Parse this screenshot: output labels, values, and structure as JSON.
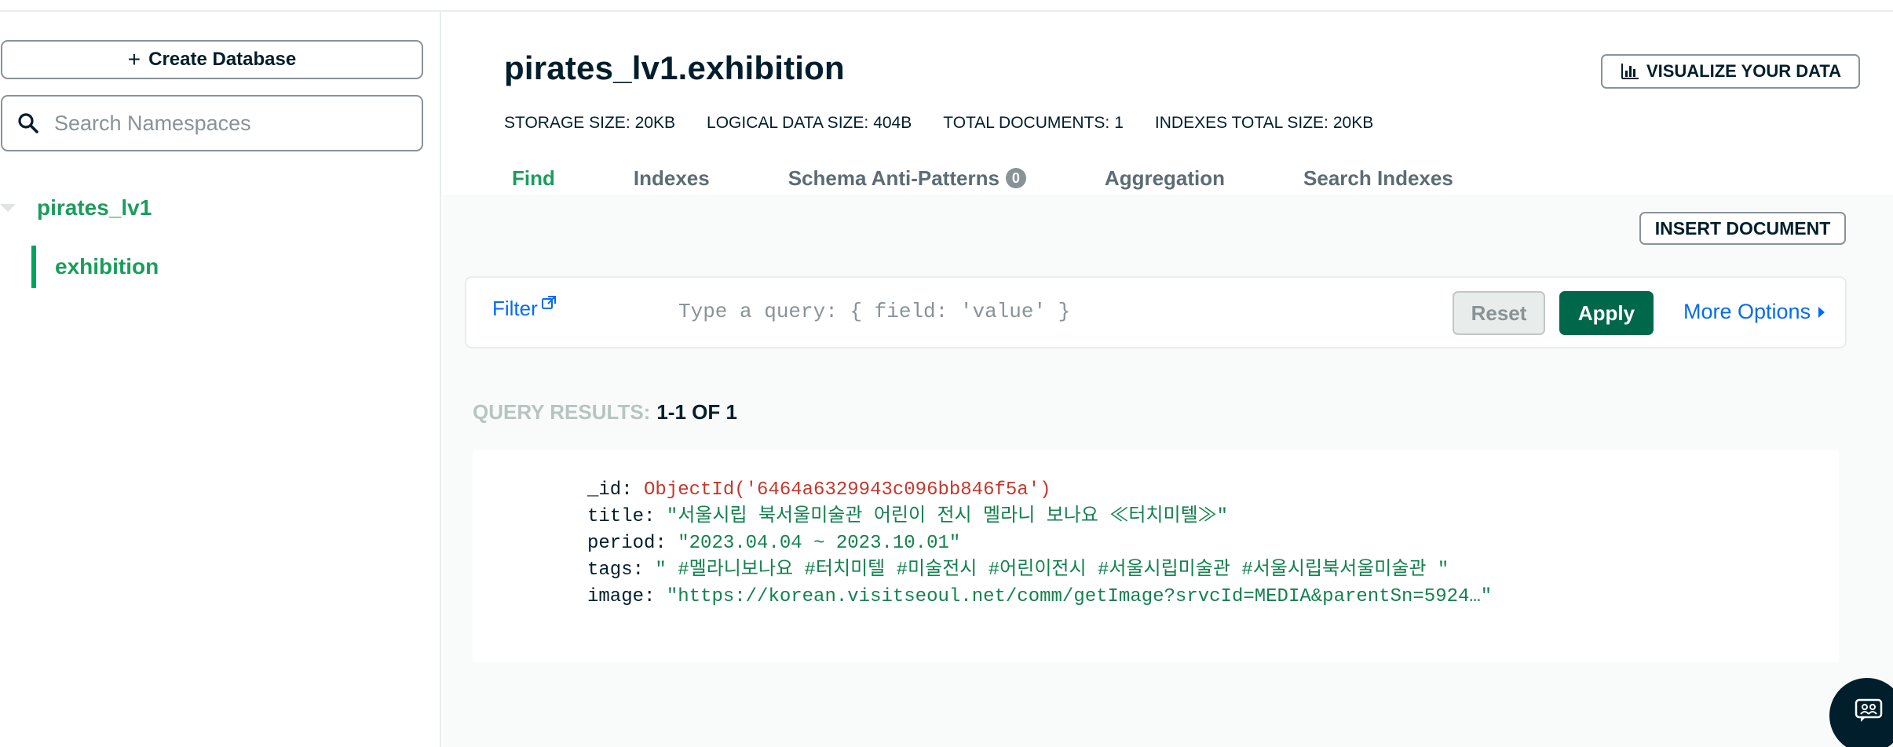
{
  "sidebar": {
    "create_database_label": "Create Database",
    "search_placeholder": "Search Namespaces",
    "database": "pirates_lv1",
    "collection": "exhibition"
  },
  "header": {
    "title": "pirates_lv1.exhibition",
    "visualize_label": "VISUALIZE YOUR DATA",
    "stats": [
      {
        "key": "STORAGE SIZE:",
        "value": "20KB"
      },
      {
        "key": "LOGICAL DATA SIZE:",
        "value": "404B"
      },
      {
        "key": "TOTAL DOCUMENTS:",
        "value": "1"
      },
      {
        "key": "INDEXES TOTAL SIZE:",
        "value": "20KB"
      }
    ]
  },
  "tabs": [
    {
      "label": "Find",
      "active": true
    },
    {
      "label": "Indexes"
    },
    {
      "label": "Schema Anti-Patterns",
      "badge": "0"
    },
    {
      "label": "Aggregation"
    },
    {
      "label": "Search Indexes"
    }
  ],
  "toolbar": {
    "insert_label": "INSERT DOCUMENT",
    "filter_label": "Filter",
    "query_placeholder": "Type a query: { field: 'value' }",
    "reset_label": "Reset",
    "apply_label": "Apply",
    "more_options_label": "More Options"
  },
  "results": {
    "label": "QUERY RESULTS:",
    "range": "1-1 OF 1"
  },
  "document": {
    "id_key": "_id:",
    "id_value": "ObjectId('6464a6329943c096bb846f5a')",
    "title_key": "title:",
    "title_value": "\"서울시립 북서울미술관 어린이 전시 멜라니 보나요 ≪터치미텔≫\"",
    "period_key": "period:",
    "period_value": "\"2023.04.04 ~ 2023.10.01\"",
    "tags_key": "tags:",
    "tags_value": "\" #멜라니보나요 #터치미텔 #미술전시 #어린이전시 #서울시립미술관 #서울시립북서울미술관 \"",
    "image_key": "image:",
    "image_value": "\"https://korean.visitseoul.net/comm/getImage?srvcId=MEDIA&parentSn=5924…\""
  },
  "colors": {
    "accent_green": "#00684a",
    "link_blue": "#016bf8",
    "nav_green": "#1a9d5c"
  }
}
